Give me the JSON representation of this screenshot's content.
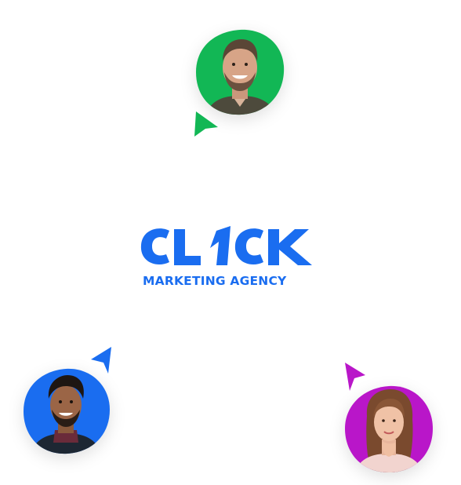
{
  "brand": {
    "word": "CL1CK",
    "tagline": "MARKETING AGENCY",
    "color": "#1a6df0"
  },
  "avatars": [
    {
      "person": "man-beard-smiling",
      "ring_color": "#12b755",
      "pointer_color": "#12b755"
    },
    {
      "person": "man-curly-hair-smiling",
      "ring_color": "#1a6df0",
      "pointer_color": "#1a6df0"
    },
    {
      "person": "woman-hand-on-chin",
      "ring_color": "#b916c9",
      "pointer_color": "#b916c9"
    }
  ]
}
